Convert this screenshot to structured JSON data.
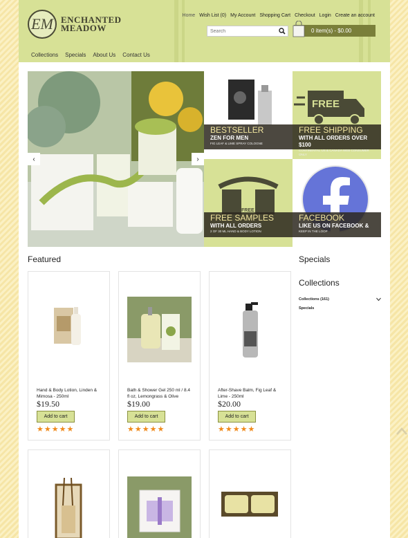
{
  "brand": {
    "monogram": "EM",
    "line1": "ENCHANTED",
    "line2": "MEADOW"
  },
  "toplinks": [
    "Home",
    "Wish List (0)",
    "My Account",
    "Shopping Cart",
    "Checkout",
    "Login",
    "Create an account"
  ],
  "search": {
    "placeholder": "Search"
  },
  "cart": {
    "label": "0 item(s) - $0.00"
  },
  "nav": [
    "Collections",
    "Specials",
    "About Us",
    "Contact Us"
  ],
  "slider": {
    "prev": "‹",
    "next": "›"
  },
  "promos": [
    {
      "title": "BESTSELLER",
      "subtitle": "ZEN FOR MEN",
      "caption": "FIG LEAF & LIME SPRAY COLOGNE"
    },
    {
      "title": "FREE SHIPPING",
      "subtitle": "WITH ALL ORDERS OVER $100",
      "caption": "CONTINENTAL US & CANADA WEB CONSUMER ONLY"
    },
    {
      "title": "FREE SAMPLES",
      "subtitle": "WITH ALL ORDERS",
      "caption": "2 OF 30 ML HAND & BODY LOTION"
    },
    {
      "title": "FACEBOOK",
      "subtitle": "LIKE US ON FACEBOOK &",
      "caption": "KEEP IN THE LOOP"
    }
  ],
  "truck_text": "FREE",
  "sample_text": "FREE",
  "featured": {
    "heading": "Featured"
  },
  "products": [
    {
      "name": "Hand & Body Lotion, Linden & Mimosa - 250ml",
      "price": "$19.50",
      "button": "Add to cart",
      "rating": 5
    },
    {
      "name": "Bath & Shower Gel 250 ml / 8.4 fl oz, Lemongrass & Olive",
      "price": "$19.00",
      "button": "Add to cart",
      "rating": 5
    },
    {
      "name": "After-Shave Balm, Fig Leaf & Lime - 250ml",
      "price": "$20.00",
      "button": "Add to cart",
      "rating": 5
    }
  ],
  "sidebar": {
    "specials_heading": "Specials",
    "collections_heading": "Collections",
    "items": [
      "Collections (161)",
      "Specials"
    ]
  },
  "colors": {
    "header": "#d7e196",
    "cart": "#7a7f3a",
    "star": "#f08a1c",
    "accent_text": "#f2e6a0"
  }
}
